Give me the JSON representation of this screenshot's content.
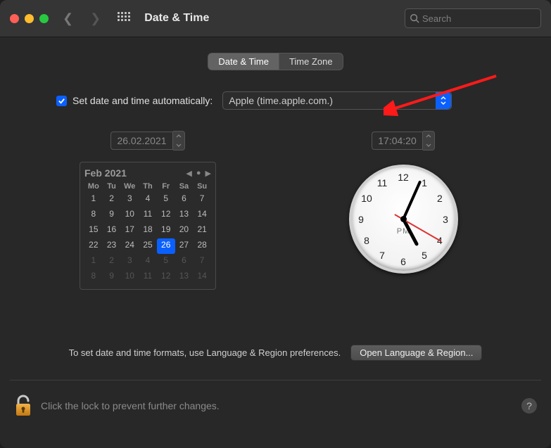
{
  "window": {
    "title": "Date & Time",
    "search_placeholder": "Search"
  },
  "tabs": {
    "date_time": "Date & Time",
    "time_zone": "Time Zone"
  },
  "auto": {
    "checked": true,
    "label": "Set date and time automatically:",
    "server": "Apple (time.apple.com.)"
  },
  "date_value": "26.02.2021",
  "time_value": "17:04:20",
  "calendar": {
    "title": "Feb 2021",
    "dow": [
      "Mo",
      "Tu",
      "We",
      "Th",
      "Fr",
      "Sa",
      "Su"
    ],
    "weeks": [
      [
        {
          "n": 1
        },
        {
          "n": 2
        },
        {
          "n": 3
        },
        {
          "n": 4
        },
        {
          "n": 5
        },
        {
          "n": 6
        },
        {
          "n": 7
        }
      ],
      [
        {
          "n": 8
        },
        {
          "n": 9
        },
        {
          "n": 10
        },
        {
          "n": 11
        },
        {
          "n": 12
        },
        {
          "n": 13
        },
        {
          "n": 14
        }
      ],
      [
        {
          "n": 15
        },
        {
          "n": 16
        },
        {
          "n": 17
        },
        {
          "n": 18
        },
        {
          "n": 19
        },
        {
          "n": 20
        },
        {
          "n": 21
        }
      ],
      [
        {
          "n": 22
        },
        {
          "n": 23
        },
        {
          "n": 24
        },
        {
          "n": 25
        },
        {
          "n": 26,
          "sel": true
        },
        {
          "n": 27
        },
        {
          "n": 28
        }
      ],
      [
        {
          "n": 1,
          "dim": true
        },
        {
          "n": 2,
          "dim": true
        },
        {
          "n": 3,
          "dim": true
        },
        {
          "n": 4,
          "dim": true
        },
        {
          "n": 5,
          "dim": true
        },
        {
          "n": 6,
          "dim": true
        },
        {
          "n": 7,
          "dim": true
        }
      ],
      [
        {
          "n": 8,
          "dim": true
        },
        {
          "n": 9,
          "dim": true
        },
        {
          "n": 10,
          "dim": true
        },
        {
          "n": 11,
          "dim": true
        },
        {
          "n": 12,
          "dim": true
        },
        {
          "n": 13,
          "dim": true
        },
        {
          "n": 14,
          "dim": true
        }
      ]
    ]
  },
  "clock": {
    "hour": 17,
    "minute": 4,
    "second": 20,
    "pm": "PM",
    "nums": [
      "12",
      "1",
      "2",
      "3",
      "4",
      "5",
      "6",
      "7",
      "8",
      "9",
      "10",
      "11"
    ]
  },
  "footer": {
    "text": "To set date and time formats, use Language & Region preferences.",
    "button": "Open Language & Region..."
  },
  "lock": {
    "text": "Click the lock to prevent further changes."
  },
  "help": "?"
}
